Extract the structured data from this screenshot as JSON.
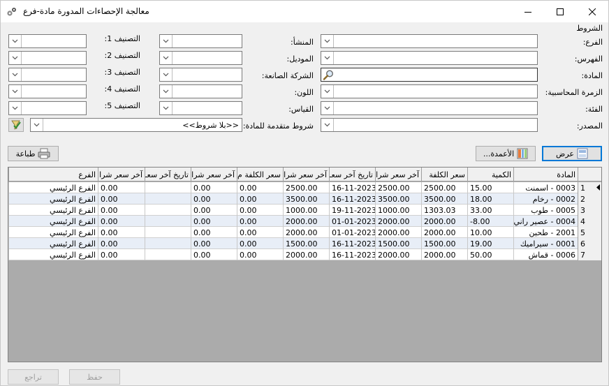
{
  "window": {
    "title": "معالجة الإحصاءات المدورة مادة-فرع",
    "app_icon": "gears-icon",
    "minimize_icon": "minimize-icon",
    "maximize_icon": "maximize-icon",
    "close_icon": "close-icon"
  },
  "conditions": {
    "group_label": "الشروط",
    "branch_label": "الفرع:",
    "index_label": "الفهرس:",
    "material_label": "المادة:",
    "accounting_group_label": "الزمرة المحاسبية:",
    "category_label": "الفئة:",
    "source_label": "المصدر:",
    "origin_label": "المنشأ:",
    "model_label": "الموديل:",
    "manufacturer_label": "الشركة الصانعة:",
    "color_label": "اللون:",
    "size_label": "القياس:",
    "advanced_conditions_label": "شروط متقدمة للمادة:",
    "advanced_conditions_value": "<<بلا شروط>>",
    "class1_label": "التصنيف 1:",
    "class2_label": "التصنيف 2:",
    "class3_label": "التصنيف 3:",
    "class4_label": "التصنيف 4:",
    "class5_label": "التصنيف 5:"
  },
  "toolbar": {
    "show_label": "عرض",
    "columns_label": "الأعمدة...",
    "print_label": "طباعة"
  },
  "grid": {
    "columns": [
      "المادة",
      "الكمية",
      "سعر الكلفة",
      "آخر سعر شرا",
      "تاريخ آخر سعـ",
      "آخر سعر شرا",
      "سعر الكلفة م",
      "آخر سعر شرا",
      "تاريخ آخر سعـ",
      "آخر سعر شرا",
      "الفرع"
    ],
    "rows": [
      {
        "n": "1",
        "material": "0003 - اسمنت",
        "qty": "15.00",
        "cost": "2500.00",
        "last_buy": "2500.00",
        "last_date": "16-11-2023",
        "last_buy2": "2500.00",
        "cost_m": "0.00",
        "last_buy3": "0.00",
        "last_date2": "",
        "last_buy4": "0.00",
        "branch": "الفرع الرئيسي"
      },
      {
        "n": "2",
        "material": "0002 - رخام",
        "qty": "18.00",
        "cost": "3500.00",
        "last_buy": "3500.00",
        "last_date": "16-11-2023",
        "last_buy2": "3500.00",
        "cost_m": "0.00",
        "last_buy3": "0.00",
        "last_date2": "",
        "last_buy4": "0.00",
        "branch": "الفرع الرئيسي"
      },
      {
        "n": "3",
        "material": "0005 - طوب",
        "qty": "33.00",
        "cost": "1303.03",
        "last_buy": "1000.00",
        "last_date": "19-11-2023",
        "last_buy2": "1000.00",
        "cost_m": "0.00",
        "last_buy3": "0.00",
        "last_date2": "",
        "last_buy4": "0.00",
        "branch": "الفرع الرئيسي"
      },
      {
        "n": "4",
        "material": "0004 - عصير راني",
        "qty": "-8.00",
        "cost": "2000.00",
        "last_buy": "2000.00",
        "last_date": "01-01-2023",
        "last_buy2": "2000.00",
        "cost_m": "0.00",
        "last_buy3": "0.00",
        "last_date2": "",
        "last_buy4": "0.00",
        "branch": "الفرع الرئيسي"
      },
      {
        "n": "5",
        "material": "2001 - طحين",
        "qty": "10.00",
        "cost": "2000.00",
        "last_buy": "2000.00",
        "last_date": "01-01-2023",
        "last_buy2": "2000.00",
        "cost_m": "0.00",
        "last_buy3": "0.00",
        "last_date2": "",
        "last_buy4": "0.00",
        "branch": "الفرع الرئيسي"
      },
      {
        "n": "6",
        "material": "0001 - سيراميك",
        "qty": "19.00",
        "cost": "1500.00",
        "last_buy": "1500.00",
        "last_date": "16-11-2023",
        "last_buy2": "1500.00",
        "cost_m": "0.00",
        "last_buy3": "0.00",
        "last_date2": "",
        "last_buy4": "0.00",
        "branch": "الفرع الرئيسي"
      },
      {
        "n": "7",
        "material": "0006 - قماش",
        "qty": "50.00",
        "cost": "2000.00",
        "last_buy": "2000.00",
        "last_date": "16-11-2023",
        "last_buy2": "2000.00",
        "cost_m": "0.00",
        "last_buy3": "0.00",
        "last_date2": "",
        "last_buy4": "0.00",
        "branch": "الفرع الرئيسي"
      }
    ]
  },
  "footer": {
    "save_label": "حفظ",
    "undo_label": "تراجع"
  }
}
